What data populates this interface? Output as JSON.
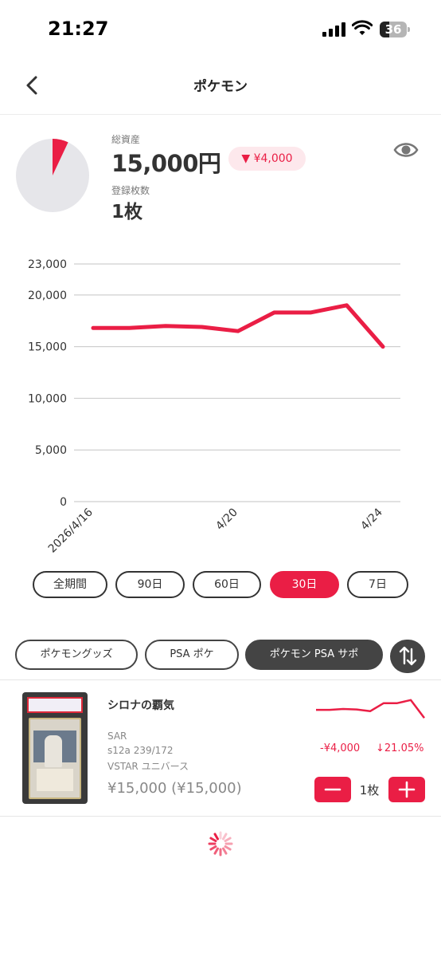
{
  "status_bar": {
    "time": "21:27",
    "battery": "36",
    "battery_level": 0.36
  },
  "nav": {
    "title": "ポケモン",
    "back_icon": "chevron-left-icon"
  },
  "summary": {
    "total_label": "総資産",
    "total_value": "15,000円",
    "change": "▼ ¥4,000",
    "count_label": "登録枚数",
    "count_value": "1枚",
    "pie_fraction": 0.07,
    "visibility_icon": "eye-icon"
  },
  "chart_data": {
    "type": "line",
    "series": [
      {
        "values": [
          16800,
          16800,
          17000,
          16900,
          16500,
          18300,
          18300,
          19000,
          15000
        ]
      }
    ],
    "x": [
      "2026/4/16",
      "2026/4/17",
      "2026/4/18",
      "2026/4/19",
      "4/20",
      "2026/4/21",
      "2026/4/22",
      "2026/4/23",
      "4/24"
    ],
    "x_tick_labels": [
      "2026/4/16",
      "4/20",
      "4/24"
    ],
    "y_ticks": [
      "23,000",
      "20,000",
      "15,000",
      "10,000",
      "5,000",
      "0"
    ],
    "ylim": [
      0,
      23000
    ],
    "grid": true,
    "color": "#ea1e45"
  },
  "periods": [
    {
      "label": "全期間",
      "active": false
    },
    {
      "label": "90日",
      "active": false
    },
    {
      "label": "60日",
      "active": false
    },
    {
      "label": "30日",
      "active": true
    },
    {
      "label": "7日",
      "active": false
    }
  ],
  "categories": [
    {
      "label": "ポケモングッズ",
      "active": false
    },
    {
      "label": "PSA ポケ",
      "active": false
    },
    {
      "label": "ポケモン PSA サポ",
      "active": true
    }
  ],
  "sort_icon": "sort-arrows-icon",
  "card": {
    "name": "シロナの覇気",
    "rarity": "SAR",
    "number": "s12a 239/172",
    "set": "VSTAR ユニバース",
    "price": "¥15,000 (¥15,000)",
    "change_amount": "-¥4,000",
    "change_percent": "↓21.05%",
    "quantity": "1枚",
    "minus_icon": "minus-icon",
    "plus_icon": "plus-icon",
    "sparkline": [
      16800,
      16800,
      17000,
      16900,
      16500,
      18300,
      18300,
      19000,
      15000
    ]
  },
  "loading_icon": "spinner-icon",
  "accent_color": "#ea1e45"
}
